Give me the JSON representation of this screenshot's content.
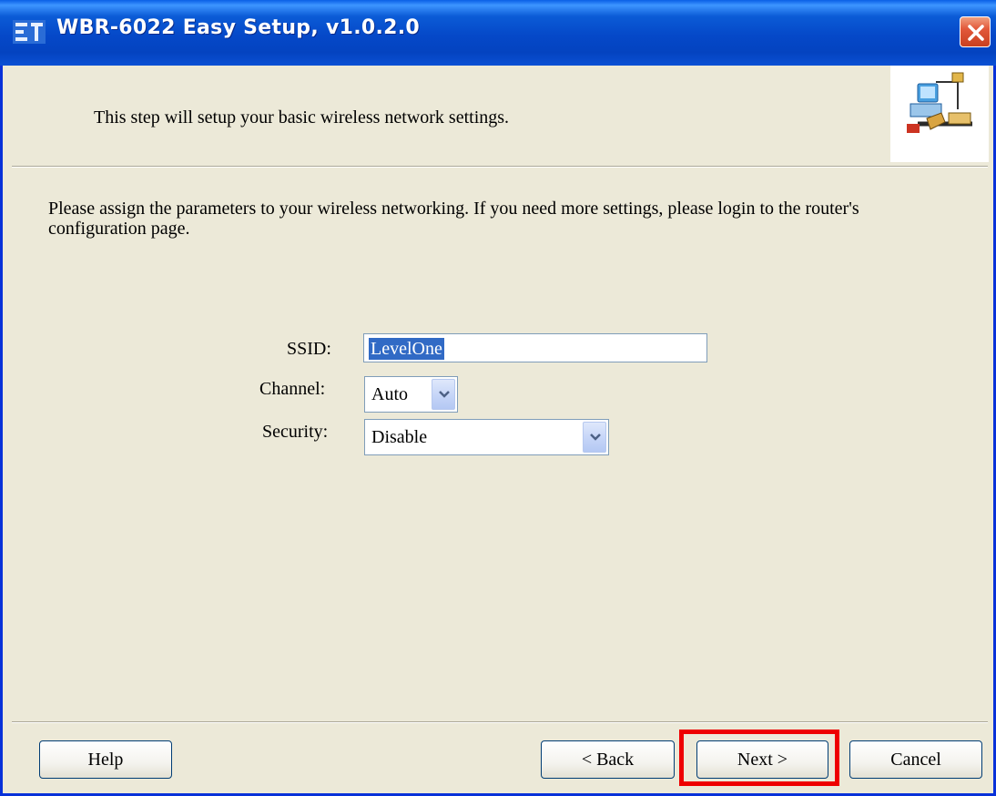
{
  "window": {
    "title": "WBR-6022 Easy Setup, v1.0.2.0",
    "title_icon": "app-icon",
    "close_icon": "close-icon"
  },
  "header": {
    "text": "This step will setup your basic wireless network settings.",
    "art_icon": "network-wizard-icon"
  },
  "body": {
    "instructions": "Please assign the parameters to your wireless networking. If you need more settings, please login to the router's configuration page."
  },
  "form": {
    "ssid_label": "SSID:",
    "ssid_value": "LevelOne",
    "channel_label": "Channel:",
    "channel_value": "Auto",
    "security_label": "Security:",
    "security_value": "Disable"
  },
  "buttons": {
    "help": "Help",
    "back": "< Back",
    "next": "Next >",
    "cancel": "Cancel"
  },
  "colors": {
    "titlebar": "#0548c8",
    "highlight": "#ee0000",
    "selection": "#316ac5"
  }
}
